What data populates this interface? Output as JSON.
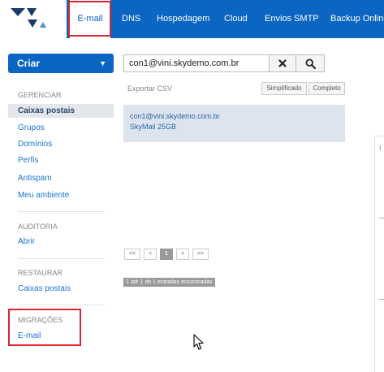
{
  "nav": {
    "items": [
      "E-mail",
      "DNS",
      "Hospedagem",
      "Cloud",
      "Envios SMTP",
      "Backup Online"
    ],
    "active": "E-mail"
  },
  "sidebar": {
    "create_label": "Criar",
    "sections": [
      {
        "title": "GERENCIAR",
        "items": [
          "Caixas postais",
          "Grupos",
          "Domínios",
          "Perfis",
          "Antispam",
          "Meu ambiente"
        ]
      },
      {
        "title": "AUDITORIA",
        "items": [
          "Abrir"
        ]
      },
      {
        "title": "RESTAURAR",
        "items": [
          "Caixas postais"
        ]
      },
      {
        "title": "MIGRAÇÕES",
        "items": [
          "E-mail"
        ]
      }
    ],
    "active_item": "Caixas postais"
  },
  "search": {
    "value": "con1@vini.skydemo.com.br"
  },
  "toolbar": {
    "export_label": "Exportar CSV",
    "simple_label": "Simplificado",
    "complete_label": "Completo"
  },
  "results": [
    {
      "email": "con1@vini.skydemo.com.br",
      "plan": "SkyMail 25GB"
    }
  ],
  "pagination": {
    "first": "<<",
    "prev": "<",
    "current": "1",
    "next": ">",
    "last": ">>"
  },
  "status_text": "1 até 1 de 1 entradas encontradas",
  "right_panel": {
    "char": "I"
  },
  "icons": {
    "clear": "times-icon",
    "search": "search-icon",
    "caret": "caret-down-icon",
    "logo": "logo-icon"
  },
  "colors": {
    "brand": "#0a66c2",
    "highlight": "#d9262d",
    "link": "#1a73d9"
  }
}
